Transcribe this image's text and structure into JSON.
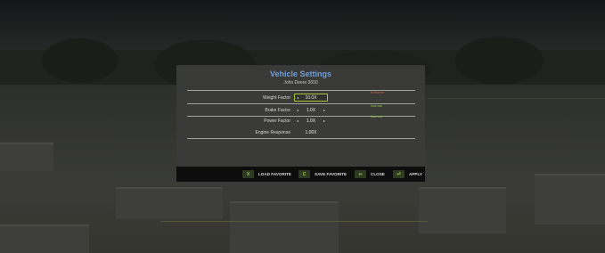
{
  "dialog": {
    "title": "Vehicle Settings",
    "subtitle": "John Deere 3650",
    "settings": [
      {
        "label": "Weight Factor",
        "value": "10.0X",
        "focused": true,
        "status": "Extreme",
        "status_color": "#d9603b"
      },
      {
        "label": "Brake Factor",
        "value": "1.0X",
        "focused": false,
        "status": "Normal",
        "status_color": "#8fc23e"
      },
      {
        "label": "Power Factor",
        "value": "1.0X",
        "focused": false,
        "status": "Normal",
        "status_color": "#8fc23e"
      },
      {
        "label": "Engine Response",
        "value": "1.00X",
        "focused": false,
        "status": "",
        "status_color": ""
      }
    ],
    "arrows": {
      "left": "◂",
      "right": "▸"
    }
  },
  "actions": [
    {
      "key": "X",
      "label": "LOAD FAVORITE"
    },
    {
      "key": "C",
      "label": "SAVE FAVORITE"
    },
    {
      "key": "⇐",
      "label": "CLOSE"
    },
    {
      "key": "⏎",
      "label": "APPLY"
    }
  ],
  "colors": {
    "accent": "#a8c63a",
    "title": "#6f9dd6"
  }
}
